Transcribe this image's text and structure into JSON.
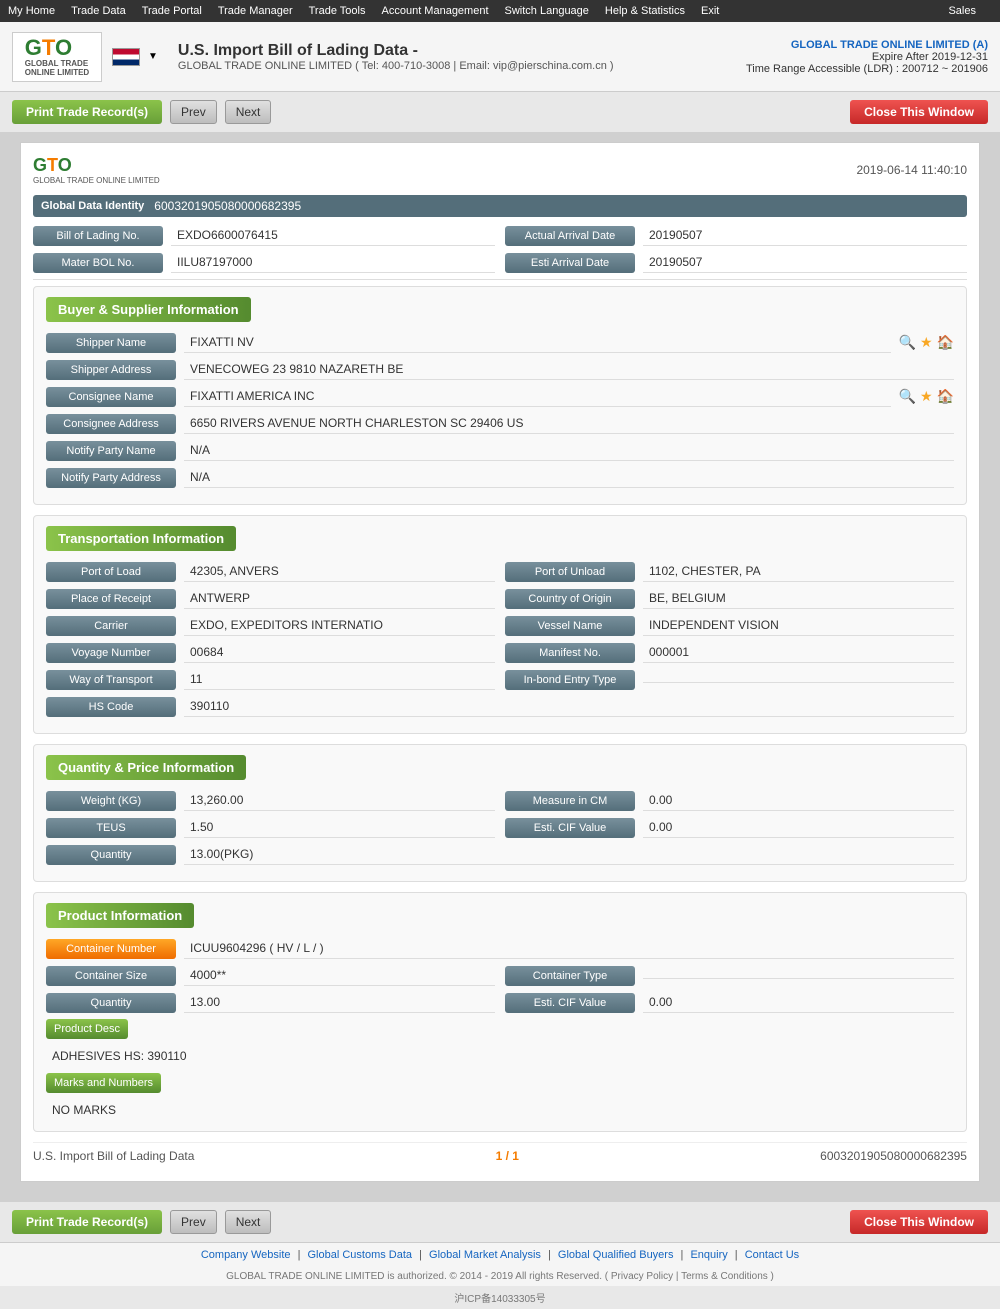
{
  "nav": {
    "items": [
      "My Home",
      "Trade Data",
      "Trade Portal",
      "Trade Manager",
      "Trade Tools",
      "Account Management",
      "Switch Language",
      "Help & Statistics",
      "Exit"
    ],
    "sales": "Sales"
  },
  "header": {
    "logo_text": "GTO",
    "logo_sub": "GLOBAL TRADE ONLINE LIMITED",
    "flag_alt": "US Flag",
    "title": "U.S. Import Bill of Lading Data",
    "title_suffix": "-",
    "contact": "GLOBAL TRADE ONLINE LIMITED ( Tel: 400-710-3008 | Email: vip@pierschina.com.cn )",
    "company_name": "GLOBAL TRADE ONLINE LIMITED (A)",
    "expire": "Expire After 2019-12-31",
    "ldr": "Time Range Accessible (LDR) : 200712 ~ 201906"
  },
  "toolbar": {
    "print_label": "Print Trade Record(s)",
    "prev_label": "Prev",
    "next_label": "Next",
    "close_label": "Close This Window"
  },
  "record": {
    "date": "2019-06-14 11:40:10",
    "global_data_identity_label": "Global Data Identity",
    "global_data_identity": "6003201905080000682395",
    "bol_label": "Bill of Lading No.",
    "bol_value": "EXDO6600076415",
    "actual_arrival_label": "Actual Arrival Date",
    "actual_arrival": "20190507",
    "mater_bol_label": "Mater BOL No.",
    "mater_bol_value": "IILU87197000",
    "esti_arrival_label": "Esti Arrival Date",
    "esti_arrival": "20190507"
  },
  "buyer_supplier": {
    "section_title": "Buyer & Supplier Information",
    "shipper_name_label": "Shipper Name",
    "shipper_name": "FIXATTI NV",
    "shipper_address_label": "Shipper Address",
    "shipper_address": "VENECOWEG 23 9810 NAZARETH BE",
    "consignee_name_label": "Consignee Name",
    "consignee_name": "FIXATTI AMERICA INC",
    "consignee_address_label": "Consignee Address",
    "consignee_address": "6650 RIVERS AVENUE NORTH CHARLESTON SC 29406 US",
    "notify_party_name_label": "Notify Party Name",
    "notify_party_name": "N/A",
    "notify_party_address_label": "Notify Party Address",
    "notify_party_address": "N/A"
  },
  "transportation": {
    "section_title": "Transportation Information",
    "port_of_load_label": "Port of Load",
    "port_of_load": "42305, ANVERS",
    "port_of_unload_label": "Port of Unload",
    "port_of_unload": "1102, CHESTER, PA",
    "place_of_receipt_label": "Place of Receipt",
    "place_of_receipt": "ANTWERP",
    "country_of_origin_label": "Country of Origin",
    "country_of_origin": "BE, BELGIUM",
    "carrier_label": "Carrier",
    "carrier": "EXDO, EXPEDITORS INTERNATIO",
    "vessel_name_label": "Vessel Name",
    "vessel_name": "INDEPENDENT VISION",
    "voyage_number_label": "Voyage Number",
    "voyage_number": "00684",
    "manifest_no_label": "Manifest No.",
    "manifest_no": "000001",
    "way_of_transport_label": "Way of Transport",
    "way_of_transport": "11",
    "inbond_entry_label": "In-bond Entry Type",
    "inbond_entry": "",
    "hs_code_label": "HS Code",
    "hs_code": "390110"
  },
  "quantity_price": {
    "section_title": "Quantity & Price Information",
    "weight_label": "Weight (KG)",
    "weight": "13,260.00",
    "measure_cm_label": "Measure in CM",
    "measure_cm": "0.00",
    "teus_label": "TEUS",
    "teus": "1.50",
    "esti_cif_label": "Esti. CIF Value",
    "esti_cif": "0.00",
    "quantity_label": "Quantity",
    "quantity": "13.00(PKG)"
  },
  "product": {
    "section_title": "Product Information",
    "container_number_label": "Container Number",
    "container_number": "ICUU9604296 ( HV / L / )",
    "container_size_label": "Container Size",
    "container_size": "4000**",
    "container_type_label": "Container Type",
    "container_type": "",
    "quantity_label": "Quantity",
    "quantity": "13.00",
    "esti_cif_label": "Esti. CIF Value",
    "esti_cif": "0.00",
    "product_desc_label": "Product Desc",
    "product_desc": "ADHESIVES HS: 390110",
    "marks_label": "Marks and Numbers",
    "marks": "NO MARKS"
  },
  "record_footer": {
    "left": "U.S. Import Bill of Lading Data",
    "center": "1 / 1",
    "right": "6003201905080000682395"
  },
  "footer": {
    "links": [
      "Company Website",
      "Global Customs Data",
      "Global Market Analysis",
      "Global Qualified Buyers",
      "Enquiry",
      "Contact Us"
    ],
    "copyright": "GLOBAL TRADE ONLINE LIMITED is authorized. © 2014 - 2019 All rights Reserved. ( Privacy Policy | Terms & Conditions )",
    "icp": "沪ICP备14033305号"
  }
}
